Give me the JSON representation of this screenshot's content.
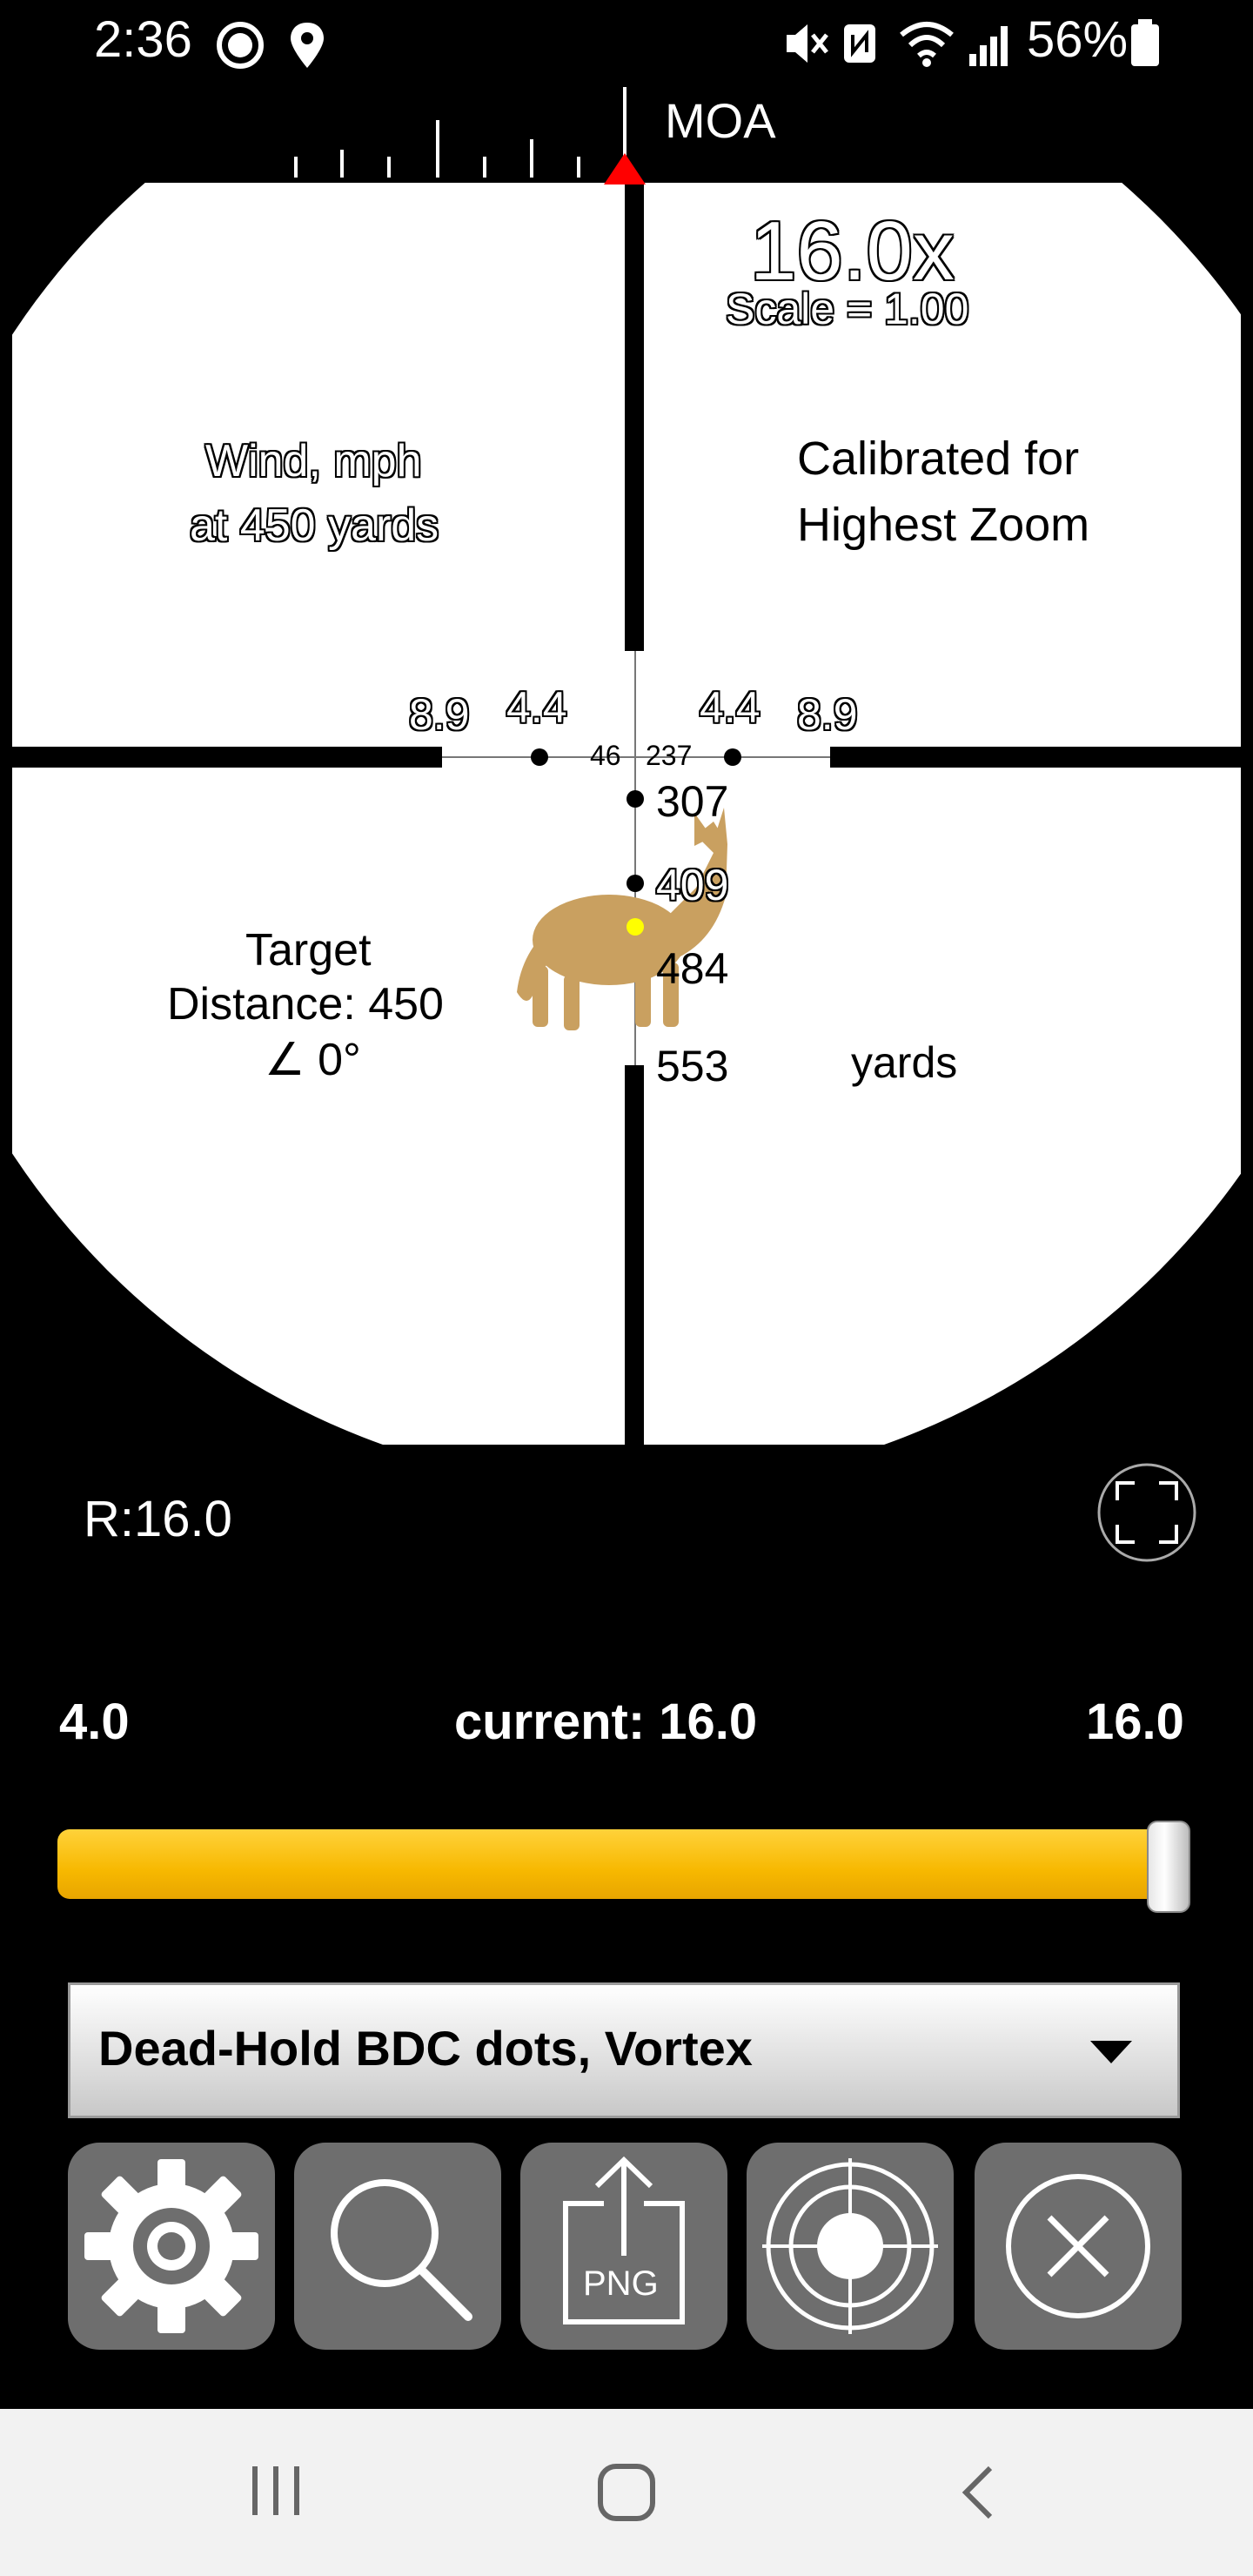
{
  "status_bar": {
    "time": "2:36",
    "battery_percent": "56%",
    "icons": [
      "notification-circle-icon",
      "location-icon",
      "mute-icon",
      "nfc-icon",
      "wifi-icon",
      "signal-icon",
      "battery-icon"
    ]
  },
  "scope": {
    "moa_label": "MOA",
    "magnification": "16.0x",
    "scale": "Scale = 1.00",
    "wind_title": "Wind, mph",
    "wind_distance": "at 450 yards",
    "calibrated_line1": "Calibrated for",
    "calibrated_line2": "Highest Zoom",
    "wind_marks": [
      "8.9",
      "4.4",
      "4.4",
      "8.9"
    ],
    "center_left": "46",
    "center_right": "237",
    "drop_distances": [
      "307",
      "409",
      "484",
      "553"
    ],
    "units": "yards",
    "target_line1": "Target",
    "target_line2": "Distance: 450",
    "target_angle": "∠ 0°",
    "target_icon": "coyote-target-icon"
  },
  "range_readout": "R:16.0",
  "zoom": {
    "min_label": "4.0",
    "current_label": "current: 16.0",
    "max_label": "16.0",
    "current_fraction": 1.0
  },
  "reticle_select": {
    "selected": "Dead-Hold BDC dots, Vortex"
  },
  "toolbar": {
    "buttons": [
      "gear-icon",
      "search-icon",
      "png-export-icon",
      "target-icon",
      "close-icon"
    ],
    "png_text": "PNG"
  },
  "colors": {
    "slider_fill": "#f7b800",
    "indicator": "#ff0000",
    "target": "#c9a060",
    "button_bg": "#6e6e6e"
  }
}
